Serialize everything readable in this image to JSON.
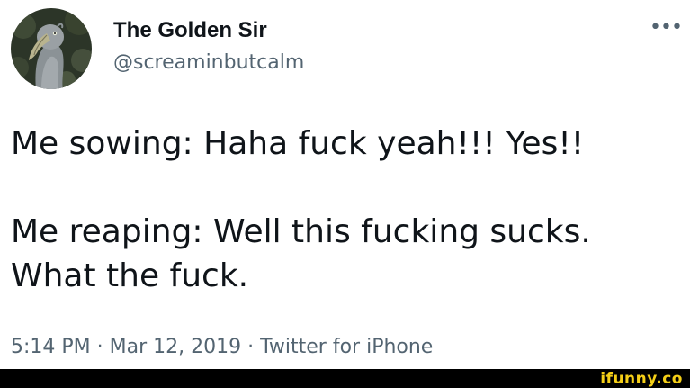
{
  "author": {
    "display_name": "The Golden Sir",
    "handle": "@screaminbutcalm",
    "avatar_icon": "shoebill-bird-avatar"
  },
  "more_label": "•••",
  "tweet": {
    "line1": "Me sowing: Haha fuck yeah!!! Yes!!",
    "line2": "Me reaping: Well this fucking sucks.",
    "line3": "What the fuck."
  },
  "meta": {
    "time": "5:14 PM",
    "separator": " · ",
    "date": "Mar 12, 2019",
    "source": "Twitter for iPhone"
  },
  "watermark": {
    "text": "ifunny.co",
    "color": "#f5cf17"
  },
  "colors": {
    "text": "#0f1419",
    "secondary": "#536471",
    "footer_bg": "#000000"
  }
}
